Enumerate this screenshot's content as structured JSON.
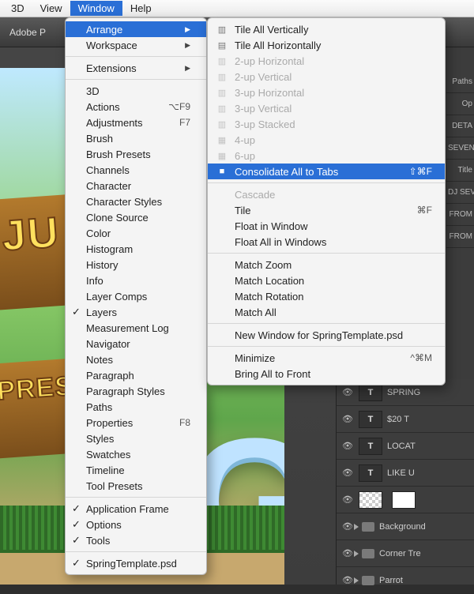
{
  "menubar": {
    "items": [
      "3D",
      "View",
      "Window",
      "Help"
    ],
    "selected": "Window"
  },
  "app": {
    "title": "Adobe P"
  },
  "tabstrip": {
    "active": ""
  },
  "canvas_text": {
    "plank1": "JU",
    "plank2": "PRES",
    "letter": "G"
  },
  "window_menu": {
    "items": [
      {
        "label": "Arrange",
        "submenu": true,
        "highlight": true
      },
      {
        "label": "Workspace",
        "submenu": true
      },
      {
        "sep": true
      },
      {
        "label": "Extensions",
        "submenu": true
      },
      {
        "sep": true
      },
      {
        "label": "3D"
      },
      {
        "label": "Actions",
        "shortcut": "⌥F9"
      },
      {
        "label": "Adjustments",
        "shortcut": "F7"
      },
      {
        "label": "Brush"
      },
      {
        "label": "Brush Presets"
      },
      {
        "label": "Channels"
      },
      {
        "label": "Character"
      },
      {
        "label": "Character Styles"
      },
      {
        "label": "Clone Source"
      },
      {
        "label": "Color"
      },
      {
        "label": "Histogram"
      },
      {
        "label": "History"
      },
      {
        "label": "Info"
      },
      {
        "label": "Layer Comps"
      },
      {
        "label": "Layers",
        "checked": true
      },
      {
        "label": "Measurement Log"
      },
      {
        "label": "Navigator"
      },
      {
        "label": "Notes"
      },
      {
        "label": "Paragraph"
      },
      {
        "label": "Paragraph Styles"
      },
      {
        "label": "Paths"
      },
      {
        "label": "Properties",
        "shortcut": "F8"
      },
      {
        "label": "Styles"
      },
      {
        "label": "Swatches"
      },
      {
        "label": "Timeline"
      },
      {
        "label": "Tool Presets"
      },
      {
        "sep": true
      },
      {
        "label": "Application Frame",
        "checked": true
      },
      {
        "label": "Options",
        "checked": true
      },
      {
        "label": "Tools",
        "checked": true
      },
      {
        "sep": true
      },
      {
        "label": "SpringTemplate.psd",
        "checked": true
      }
    ]
  },
  "arrange_menu": {
    "items": [
      {
        "icon": "▥",
        "label": "Tile All Vertically"
      },
      {
        "icon": "▤",
        "label": "Tile All Horizontally"
      },
      {
        "icon": "▥",
        "label": "2-up Horizontal",
        "disabled": true
      },
      {
        "icon": "▥",
        "label": "2-up Vertical",
        "disabled": true
      },
      {
        "icon": "▥",
        "label": "3-up Horizontal",
        "disabled": true
      },
      {
        "icon": "▥",
        "label": "3-up Vertical",
        "disabled": true
      },
      {
        "icon": "▥",
        "label": "3-up Stacked",
        "disabled": true
      },
      {
        "icon": "▦",
        "label": "4-up",
        "disabled": true
      },
      {
        "icon": "▦",
        "label": "6-up",
        "disabled": true
      },
      {
        "icon": "■",
        "label": "Consolidate All to Tabs",
        "highlight": true,
        "shortcut": "⇧⌘F"
      },
      {
        "sep": true
      },
      {
        "label": "Cascade",
        "disabled": true
      },
      {
        "label": "Tile",
        "shortcut": "⌘F"
      },
      {
        "label": "Float in Window"
      },
      {
        "label": "Float All in Windows"
      },
      {
        "sep": true
      },
      {
        "label": "Match Zoom"
      },
      {
        "label": "Match Location"
      },
      {
        "label": "Match Rotation"
      },
      {
        "label": "Match All"
      },
      {
        "sep": true
      },
      {
        "label": "New Window for SpringTemplate.psd"
      },
      {
        "sep": true
      },
      {
        "label": "Minimize",
        "shortcut": "^⌘M"
      },
      {
        "label": "Bring All to Front"
      }
    ]
  },
  "right_labels": [
    "Paths",
    "Op",
    "DETA",
    "SEVENS",
    "Title",
    "DJ SEV",
    "FROM",
    "FROM"
  ],
  "layers": [
    {
      "type": "T",
      "name": "SPRING"
    },
    {
      "type": "T",
      "name": "$20 T"
    },
    {
      "type": "T",
      "name": "LOCAT"
    },
    {
      "type": "T",
      "name": "LIKE U"
    },
    {
      "type": "thumb",
      "name": ""
    },
    {
      "type": "folder",
      "name": "Background"
    },
    {
      "type": "folder",
      "name": "Corner Tre"
    },
    {
      "type": "folder",
      "name": "Parrot"
    }
  ]
}
